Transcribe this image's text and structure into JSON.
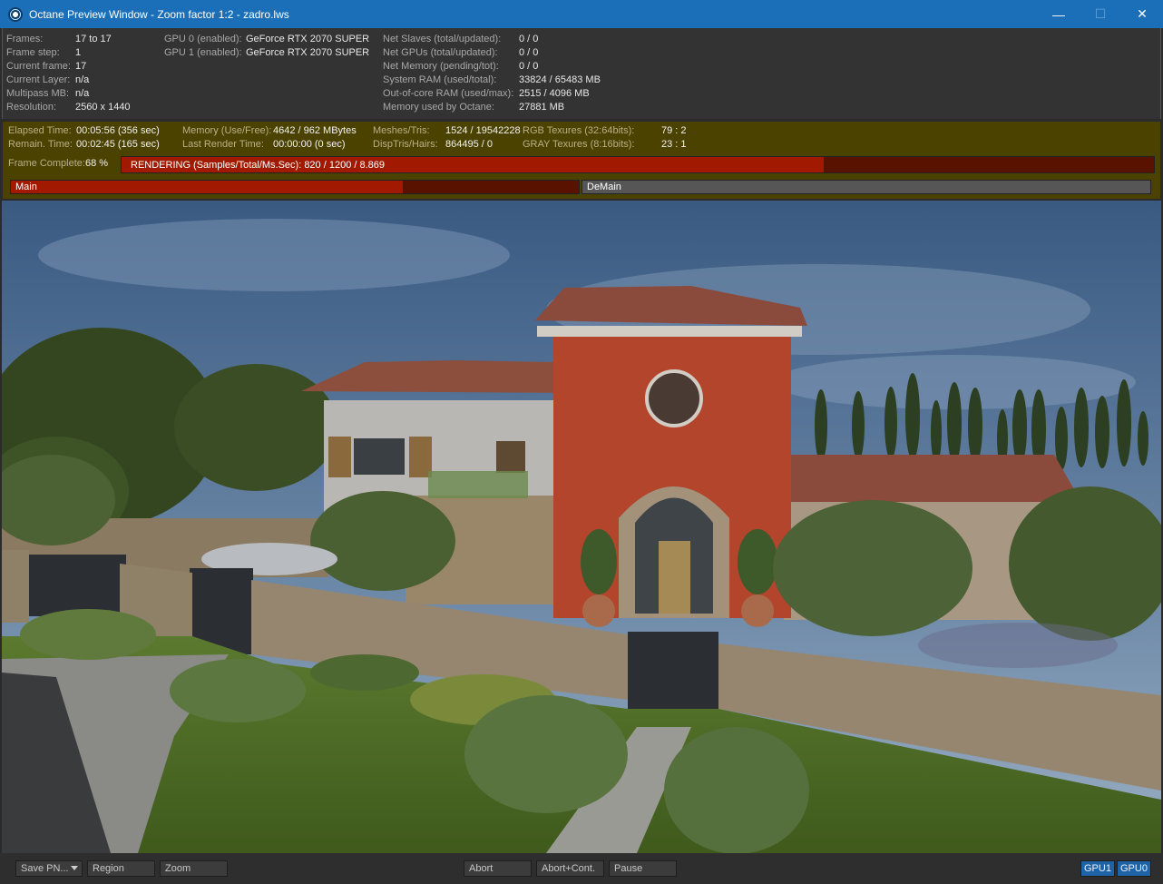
{
  "window": {
    "title": "Octane Preview Window - Zoom factor 1:2 - zadro.lws",
    "minimize": "—",
    "maximize": "☐",
    "close": "✕"
  },
  "info": {
    "frames_label": "Frames:",
    "frames_value": "17 to 17",
    "frame_step_label": "Frame step:",
    "frame_step_value": "1",
    "current_frame_label": "Current frame:",
    "current_frame_value": "17",
    "current_layer_label": "Current Layer:",
    "current_layer_value": "n/a",
    "multipass_label": "Multipass MB:",
    "multipass_value": "n/a",
    "resolution_label": "Resolution:",
    "resolution_value": "2560 x 1440",
    "gpu0_label": "GPU  0 (enabled):",
    "gpu0_value": "GeForce RTX 2070 SUPER",
    "gpu1_label": "GPU  1 (enabled):",
    "gpu1_value": "GeForce RTX 2070 SUPER",
    "net_slaves_label": "Net Slaves (total/updated):",
    "net_slaves_value": "0 / 0",
    "net_gpus_label": "Net GPUs (total/updated):",
    "net_gpus_value": "0 / 0",
    "net_memory_label": "Net Memory (pending/tot):",
    "net_memory_value": "0 / 0",
    "system_ram_label": "System RAM (used/total):",
    "system_ram_value": "33824 / 65483 MB",
    "out_of_core_label": "Out-of-core RAM (used/max):",
    "out_of_core_value": "2515 / 4096 MB",
    "octane_memory_label": "Memory used by Octane:",
    "octane_memory_value": "27881 MB"
  },
  "stats": {
    "elapsed_label": "Elapsed Time:",
    "elapsed_value": "00:05:56 (356 sec)",
    "remain_label": "Remain. Time:",
    "remain_value": "00:02:45 (165 sec)",
    "memory_label": "Memory (Use/Free):",
    "memory_value": "4642 / 962 MBytes",
    "last_render_label": "Last Render Time:",
    "last_render_value": "00:00:00 (0 sec)",
    "meshes_label": "Meshes/Tris:",
    "meshes_value": "1524 / 19542228",
    "disp_label": "DispTris/Hairs:",
    "disp_value": "864495 / 0",
    "rgb_label": "RGB Texures (32:64bits):",
    "rgb_value": "79 : 2",
    "gray_label": "GRAY Texures (8:16bits):",
    "gray_value": "23 : 1",
    "frame_complete_label": "Frame Complete:",
    "frame_complete_value": "68 %",
    "rendering_text": "RENDERING (Samples/Total/Ms.Sec): 820 / 1200 / 8.869",
    "rendering_progress": 0.68,
    "layer_main_label": "Main",
    "layer_main_progress": 0.69,
    "layer_demain_label": "DeMain",
    "layer_demain_progress": 0.0
  },
  "colors": {
    "titlebar": "#1a6fb8",
    "stats_band": "#4b4200",
    "progress_fill": "#a11a00",
    "gpu_active": "#1e63a6"
  },
  "toolbar": {
    "save_select": "Save PN...",
    "region": "Region",
    "zoom": "Zoom",
    "abort": "Abort",
    "abort_cont": "Abort+Cont.",
    "pause": "Pause",
    "gpu1": "GPU1",
    "gpu0": "GPU0"
  }
}
